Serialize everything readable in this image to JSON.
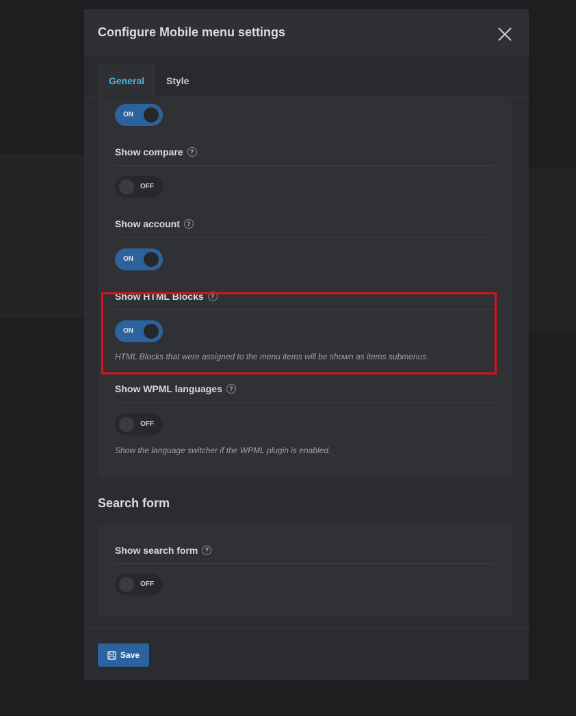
{
  "modal": {
    "title": "Configure Mobile menu settings"
  },
  "tabs": [
    {
      "label": "General",
      "active": true
    },
    {
      "label": "Style",
      "active": false
    }
  ],
  "fields": [
    {
      "label": "",
      "state": "ON"
    },
    {
      "label": "Show compare",
      "state": "OFF"
    },
    {
      "label": "Show account",
      "state": "ON"
    },
    {
      "label": "Show HTML Blocks",
      "state": "ON",
      "description": "HTML Blocks that were assigned to the menu items will be shown as items submenus."
    },
    {
      "label": "Show WPML languages",
      "state": "OFF",
      "description": "Show the language switcher if the WPML plugin is enabled."
    }
  ],
  "search_section": {
    "title": "Search form",
    "field_label": "Show search form",
    "state": "OFF"
  },
  "help_glyph": "?",
  "footer": {
    "save_label": "Save"
  },
  "colors": {
    "accent": "#2c639f",
    "active_tab": "#4ab7e6",
    "highlight": "#e0101a"
  }
}
